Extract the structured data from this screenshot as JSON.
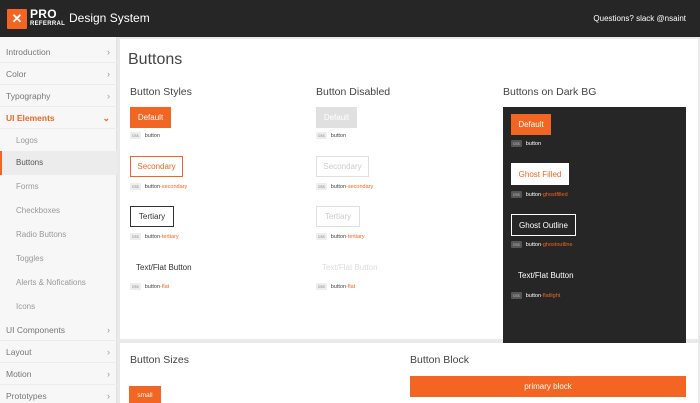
{
  "header": {
    "logo_pro": "PRO",
    "logo_referral": "REFERRAL",
    "title": "Design System",
    "questions": "Questions? slack @nsaint"
  },
  "sidebar": {
    "items": [
      {
        "label": "Introduction"
      },
      {
        "label": "Color"
      },
      {
        "label": "Typography"
      },
      {
        "label": "UI Elements"
      },
      {
        "label": "UI Components"
      },
      {
        "label": "Layout"
      },
      {
        "label": "Motion"
      },
      {
        "label": "Prototypes"
      }
    ],
    "subitems": [
      {
        "label": "Logos"
      },
      {
        "label": "Buttons"
      },
      {
        "label": "Forms"
      },
      {
        "label": "Checkboxes"
      },
      {
        "label": "Radio Buttons"
      },
      {
        "label": "Toggles"
      },
      {
        "label": "Alerts & Nofications"
      },
      {
        "label": "Icons"
      }
    ],
    "active_item": "UI Elements",
    "selected_subitem": "Buttons"
  },
  "main": {
    "page_title": "Buttons",
    "styles": {
      "title": "Button Styles",
      "default": {
        "label": "Default",
        "css": "button",
        "mod": ""
      },
      "secondary": {
        "label": "Secondary",
        "css": "button",
        "mod": "-secondary"
      },
      "tertiary": {
        "label": "Tertiary",
        "css": "button",
        "mod": "-tertiary"
      },
      "flat": {
        "label": "Text/Flat Button",
        "css": "button",
        "mod": "-flat"
      }
    },
    "disabled": {
      "title": "Button Disabled",
      "default": {
        "label": "Default",
        "css": "button",
        "mod": ""
      },
      "secondary": {
        "label": "Secondary",
        "css": "button",
        "mod": "-secondary"
      },
      "tertiary": {
        "label": "Tertiary",
        "css": "button",
        "mod": "-tertiary"
      },
      "flat": {
        "label": "Text/Flat Button",
        "css": "button",
        "mod": "-flat"
      }
    },
    "dark": {
      "title": "Buttons on Dark BG",
      "default": {
        "label": "Default",
        "css": "button",
        "mod": ""
      },
      "ghost_filled": {
        "label": "Ghost Filled",
        "css": "button",
        "mod": "-ghostfilled"
      },
      "ghost_outline": {
        "label": "Ghost Outline",
        "css": "button",
        "mod": "-ghostoutline"
      },
      "flat": {
        "label": "Text/Flat Button",
        "css": "button",
        "mod": "-flatlight"
      }
    },
    "css_tag": "css"
  },
  "lower": {
    "sizes_title": "Button Sizes",
    "small_label": "small",
    "block_title": "Button Block",
    "block_label": "primary block"
  },
  "colors": {
    "accent": "#f26522",
    "header_bg": "#262626",
    "dark_panel_bg": "#262626"
  }
}
